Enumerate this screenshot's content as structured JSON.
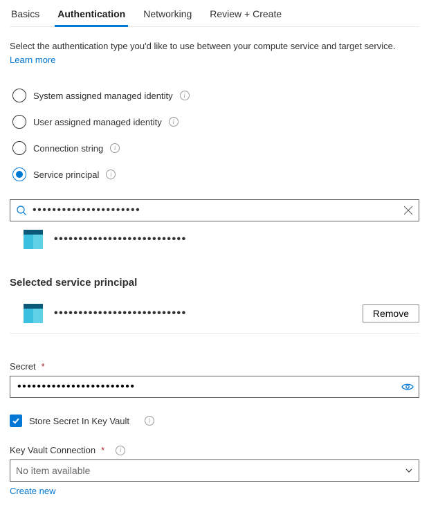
{
  "tabs": {
    "basics": "Basics",
    "authentication": "Authentication",
    "networking": "Networking",
    "review": "Review + Create"
  },
  "intro": {
    "text": "Select the authentication type you'd like to use between your compute service and target service. ",
    "link": "Learn more"
  },
  "auth_options": {
    "system": "System assigned managed identity",
    "user": "User assigned managed identity",
    "conn": "Connection string",
    "sp": "Service principal"
  },
  "search": {
    "value": "••••••••••••••••••••••"
  },
  "result_name": "•••••••••••••••••••••••••••",
  "selected_section": "Selected service principal",
  "selected_name": "•••••••••••••••••••••••••••",
  "remove_label": "Remove",
  "secret": {
    "label": "Secret",
    "value": "••••••••••••••••••••••••"
  },
  "store_label": "Store Secret In Key Vault",
  "kv": {
    "label": "Key Vault Connection",
    "placeholder": "No item available"
  },
  "create_new": "Create new"
}
